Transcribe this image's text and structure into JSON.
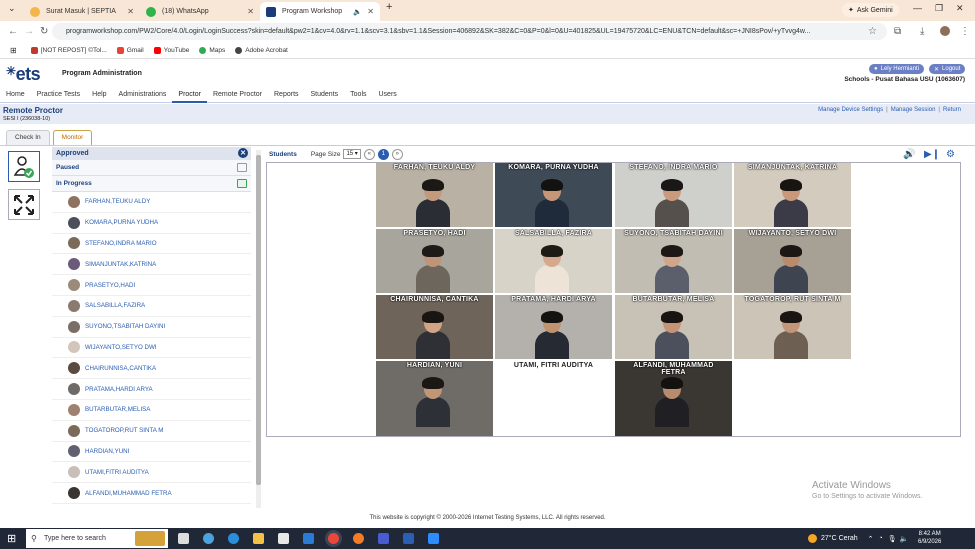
{
  "browser": {
    "tabs": [
      {
        "title": "Surat Masuk | SEPTIA",
        "color": "#f3b64a"
      },
      {
        "title": "(18) WhatsApp",
        "color": "#2fb34a"
      },
      {
        "title": "Program Workshop",
        "color": "#1a3c7a"
      }
    ],
    "ask_gemini": "Ask Gemini",
    "url": "programworkshop.com/PW2/Core/4.0/Login/LoginSuccess?skin=default&pw2=1&cv=4.0&rv=1.1&scv=3.1&sbv=1.1&Session=406892&SK=382&C=0&P=0&l=0&U=401825&UL=19475720&LC=ENU&TCN=default&sc=+JNI8sPov/+yTvvg4w...",
    "bookmarks": [
      "[NOT REPOST] ©Tol...",
      "Gmail",
      "YouTube",
      "Maps",
      "Adobe Acrobat"
    ]
  },
  "header": {
    "logo": "ets",
    "program": "Program Administration",
    "user_button": "Lely Hermianti",
    "logout_button": "Logout",
    "school": "Schools - Pusat Bahasa USU (1063607)"
  },
  "menu": [
    "Home",
    "Practice Tests",
    "Help",
    "Administrations",
    "Proctor",
    "Remote Proctor",
    "Reports",
    "Students",
    "Tools",
    "Users"
  ],
  "menu_active": "Proctor",
  "section": {
    "title": "Remote Proctor",
    "session": "SESI I (236038-10)",
    "links": [
      "Manage Device Settings",
      "Manage Session",
      "Return"
    ]
  },
  "subtabs": [
    "Check In",
    "Monitor"
  ],
  "subtab_active": "Monitor",
  "candidates": {
    "header": "Approved",
    "paused": "Paused",
    "in_progress": "In Progress",
    "list": [
      "FARHAN,TEUKU ALDY",
      "KOMARA,PURNA YUDHA",
      "STEFANO,INDRA MARIO",
      "SIMANJUNTAK,KATRINA",
      "PRASETYO,HADI",
      "SALSABILLA,FAZIRA",
      "SUYONO,TSABITAH DAYINI",
      "WIJAYANTO,SETYO DWI",
      "CHAIRUNNISA,CANTIKA",
      "PRATAMA,HARDI ARYA",
      "BUTARBUTAR,MELISA",
      "TOGATOROP,RUT SINTA M",
      "HARDIAN,YUNI",
      "UTAMI,FITRI AUDITYA",
      "ALFANDI,MUHAMMAD FETRA"
    ]
  },
  "students_bar": {
    "label": "Students",
    "page_size_label": "Page Size",
    "page_size": "15",
    "current_page": "1"
  },
  "videos": [
    {
      "name": "FARHAN, TEUKU ALDY",
      "bg": "#b9b2a4",
      "skin": "#c39a7d",
      "shirt": "#2b2d35",
      "hair": "#1c1915"
    },
    {
      "name": "KOMARA, PURNA YUDHA",
      "bg": "#3f4a57",
      "skin": "#c79679",
      "shirt": "#1f2a3a",
      "hair": "#141210"
    },
    {
      "name": "STEFANO, INDRA MARIO",
      "bg": "#cfcfcb",
      "skin": "#c89a7e",
      "shirt": "#55504b",
      "hair": "#1a1816"
    },
    {
      "name": "SIMANJUNTAK, KATRINA",
      "bg": "#d3cbbd",
      "skin": "#c9977a",
      "shirt": "#3b3b47",
      "hair": "#181412"
    },
    {
      "name": "PRASETYO, HADI",
      "bg": "#a8a59c",
      "skin": "#c09479",
      "shirt": "#6c665d",
      "hair": "#1d1a17"
    },
    {
      "name": "SALSABILLA, FAZIRA",
      "bg": "#d8d3c8",
      "skin": "#d4a98d",
      "shirt": "#ede3d6",
      "hair": "#1e1a16"
    },
    {
      "name": "SUYONO, TSABITAH DAYINI",
      "bg": "#c2bdb2",
      "skin": "#d0a68b",
      "shirt": "#5b5e6b",
      "hair": "#1c1815"
    },
    {
      "name": "WIJAYANTO, SETYO DWI",
      "bg": "#a7a094",
      "skin": "#b98b6d",
      "shirt": "#3e4450",
      "hair": "#1a1714"
    },
    {
      "name": "CHAIRUNNISA, CANTIKA",
      "bg": "#6e6459",
      "skin": "#d2a485",
      "shirt": "#2f2f36",
      "hair": "#191512"
    },
    {
      "name": "PRATAMA, HARDI ARYA",
      "bg": "#b4b1ad",
      "skin": "#c1936f",
      "shirt": "#262a32",
      "hair": "#151311"
    },
    {
      "name": "BUTARBUTAR, MELISA",
      "bg": "#c8c1b5",
      "skin": "#c59378",
      "shirt": "#4c4f5c",
      "hair": "#181411"
    },
    {
      "name": "TOGATOROP, RUT SINTA M",
      "bg": "#ccc4b7",
      "skin": "#c39579",
      "shirt": "#6d5f52",
      "hair": "#1a1512"
    },
    {
      "name": "HARDIAN, YUNI",
      "bg": "#6f6b66",
      "skin": "#c19677",
      "shirt": "#2d3036",
      "hair": "#1a1714"
    },
    {
      "name": "UTAMI, FITRI AUDITYA",
      "bg": "#ffffff",
      "skin": "",
      "shirt": "",
      "hair": ""
    },
    {
      "name": "ALFANDI, MUHAMMAD FETRA",
      "bg": "#3a3631",
      "skin": "#b88a6e",
      "shirt": "#1f1f24",
      "hair": "#141210"
    }
  ],
  "footer": {
    "copyright": "This website is copyright © 2000-2026 Internet Testing Systems, LLC. All rights reserved.",
    "activate_title": "Activate Windows",
    "activate_sub": "Go to Settings to activate Windows."
  },
  "taskbar": {
    "search_placeholder": "Type here to search",
    "weather": "27°C  Cerah",
    "time": "8:42 AM",
    "date": "6/9/2026"
  }
}
